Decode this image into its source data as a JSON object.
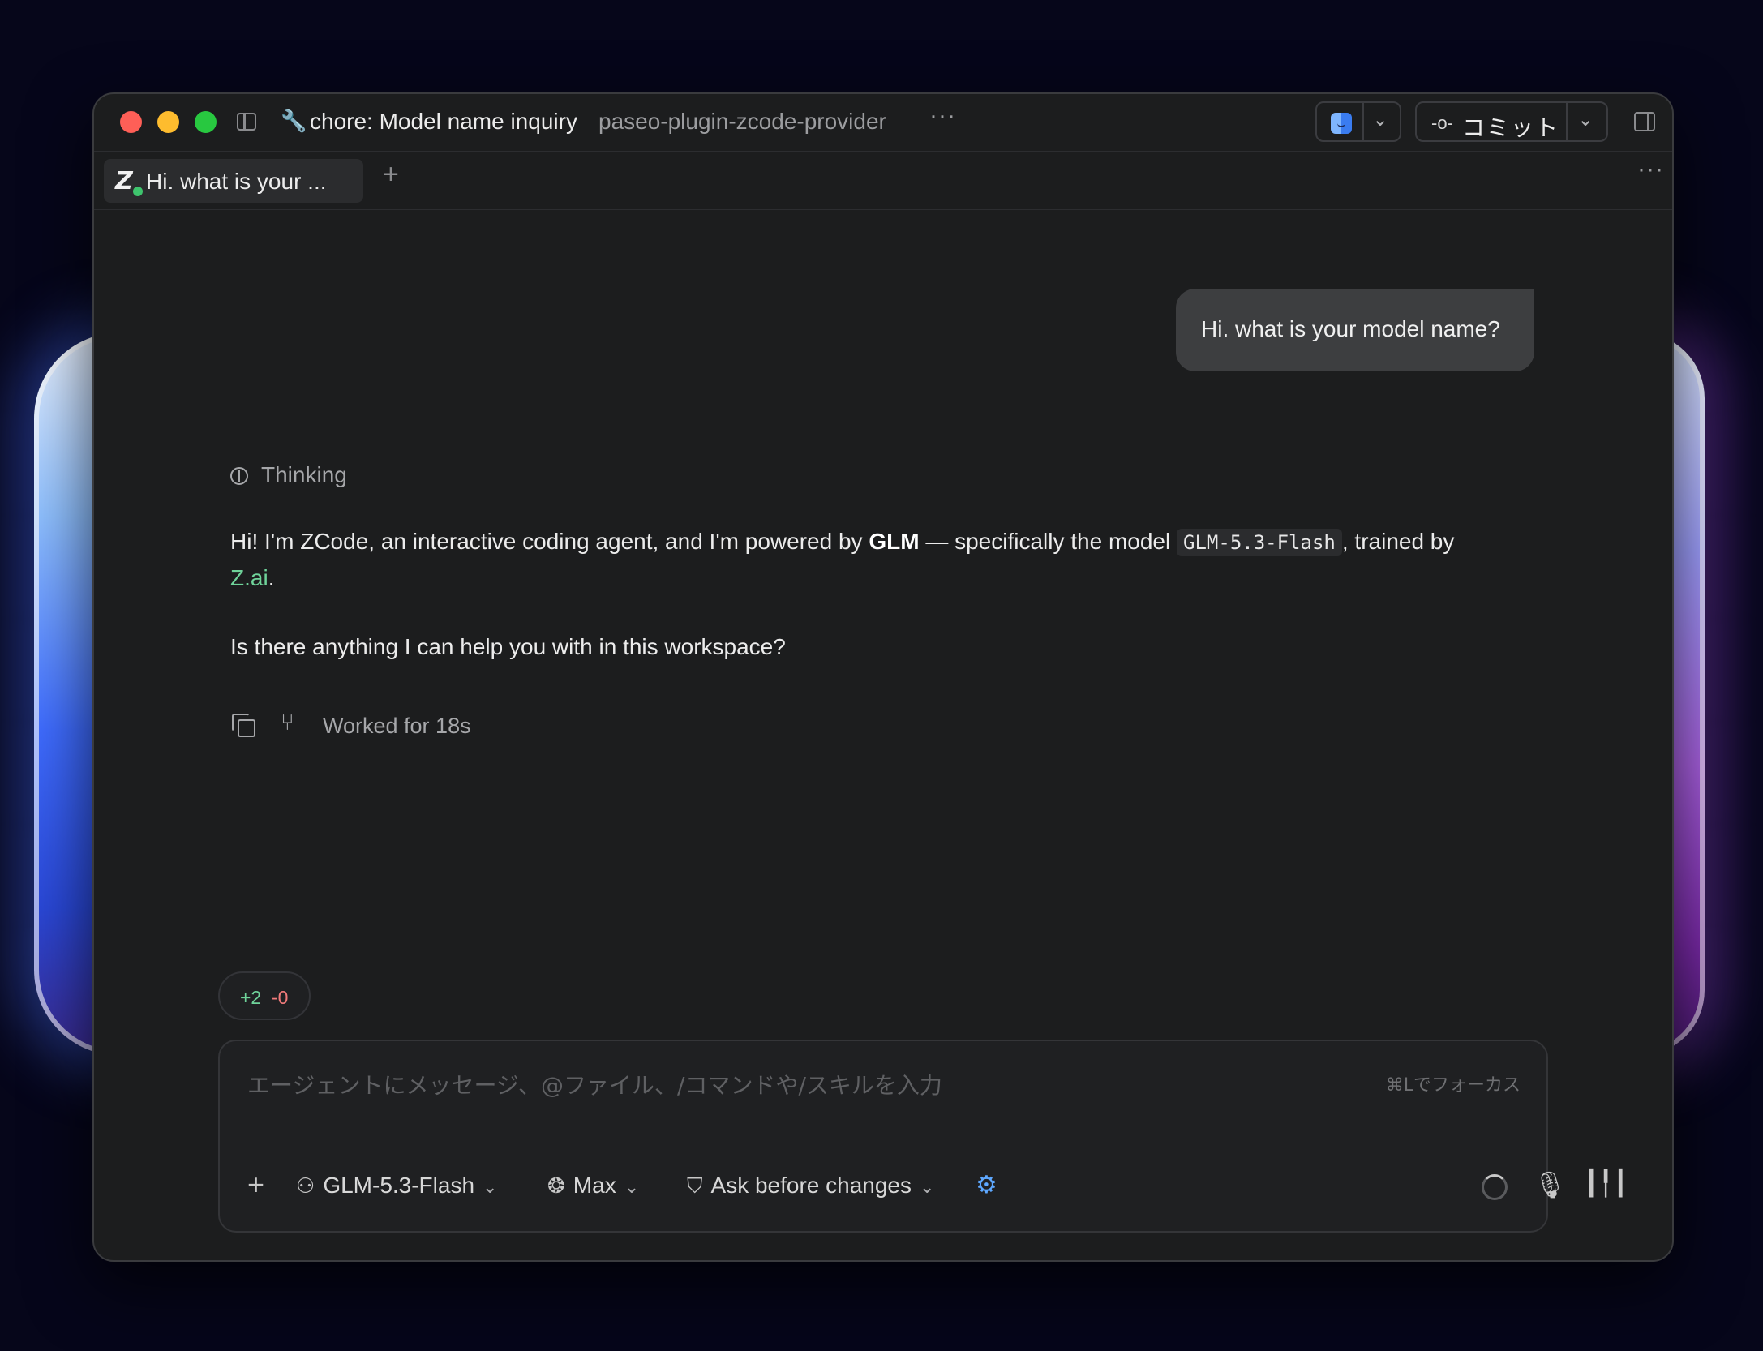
{
  "window": {
    "title": "chore: Model name inquiry",
    "repo": "paseo-plugin-zcode-provider",
    "more_label": "···"
  },
  "toolbar": {
    "commit_label": "コミット"
  },
  "tabs": [
    {
      "label": "Hi. what is your ...",
      "status": "active",
      "status_color": "#3ec46d"
    }
  ],
  "tabbar": {
    "add_label": "+",
    "more_label": "···"
  },
  "conversation": {
    "user_message": "Hi. what is your model name?",
    "thinking_label": "Thinking",
    "reply": {
      "part1": "Hi! I'm ZCode, an interactive coding agent, and I'm powered by ",
      "bold": "GLM",
      "part2": " — specifically the model ",
      "code": "GLM-5.3-Flash",
      "part3": ", trained by ",
      "link": "Z.ai",
      "part4": ".",
      "followup": "Is there anything I can help you with in this workspace?"
    },
    "worked_label": "Worked for 18s"
  },
  "diff": {
    "added": "+2",
    "removed": "-0"
  },
  "composer": {
    "placeholder": "エージェントにメッセージ、@ファイル、/コマンドや/スキルを入力",
    "focus_hint": "⌘Lでフォーカス",
    "model": "GLM-5.3-Flash",
    "effort": "Max",
    "permission": "Ask before changes"
  },
  "colors": {
    "accent_green": "#6fd39a",
    "accent_red": "#f07a7a",
    "accent_blue": "#5ea8ff"
  }
}
